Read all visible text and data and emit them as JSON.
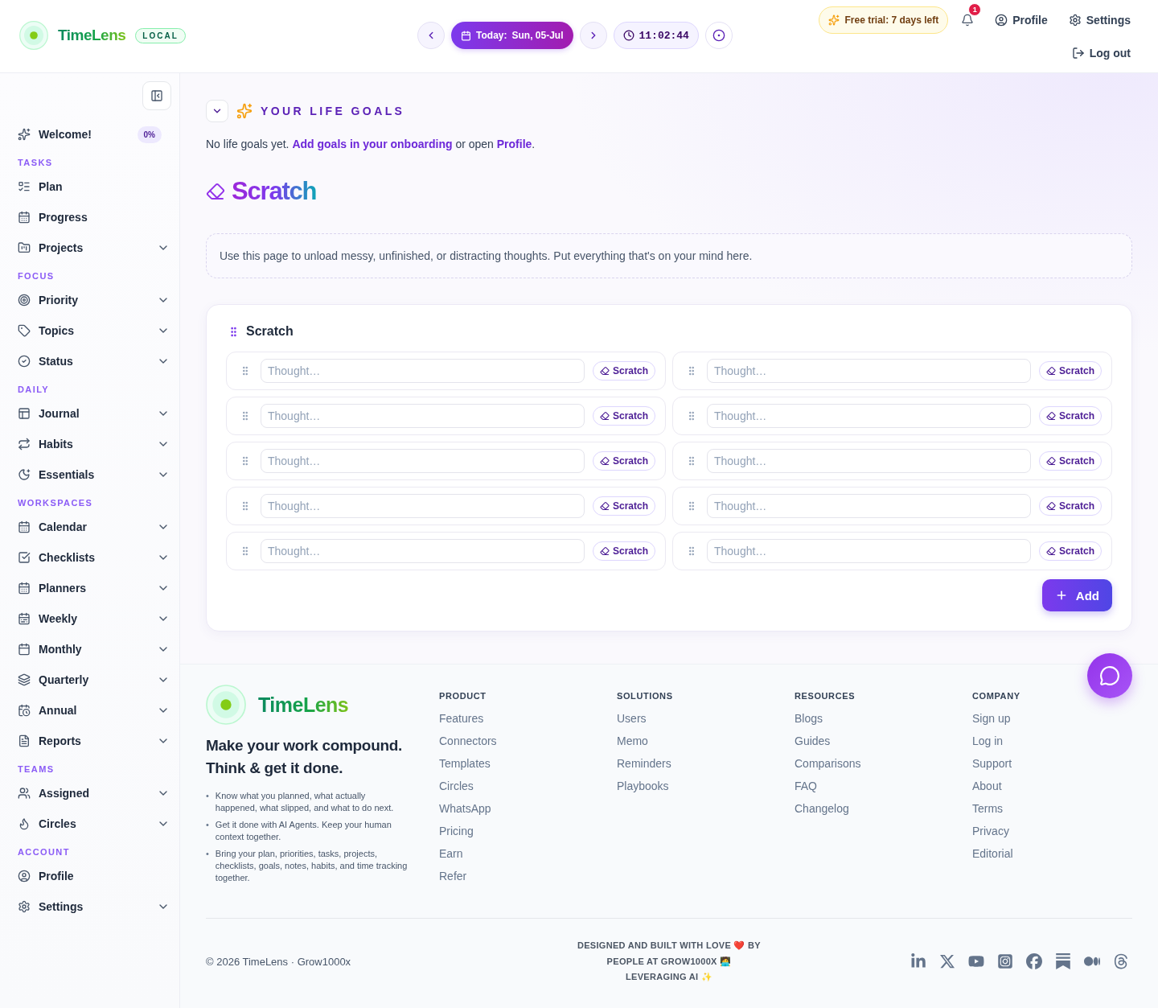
{
  "header": {
    "brand": "TimeLens",
    "badge": "LOCAL",
    "date": {
      "label": "Today:",
      "value": "Sun, 05-Jul"
    },
    "time": "11:02:44",
    "trial": "Free trial: 7 days left",
    "notifications": "1",
    "profile": "Profile",
    "settings": "Settings",
    "logout": "Log out"
  },
  "sidebar": {
    "welcome": {
      "label": "Welcome!",
      "progress": "0%"
    },
    "sections": [
      {
        "title": "TASKS",
        "items": [
          {
            "label": "Plan",
            "kind": "link"
          },
          {
            "label": "Progress",
            "kind": "link"
          },
          {
            "label": "Projects",
            "kind": "group"
          }
        ]
      },
      {
        "title": "FOCUS",
        "items": [
          {
            "label": "Priority",
            "kind": "group"
          },
          {
            "label": "Topics",
            "kind": "group"
          },
          {
            "label": "Status",
            "kind": "group"
          }
        ]
      },
      {
        "title": "DAILY",
        "items": [
          {
            "label": "Journal",
            "kind": "group"
          },
          {
            "label": "Habits",
            "kind": "group"
          },
          {
            "label": "Essentials",
            "kind": "group"
          }
        ]
      },
      {
        "title": "WORKSPACES",
        "items": [
          {
            "label": "Calendar",
            "kind": "group"
          },
          {
            "label": "Checklists",
            "kind": "group"
          },
          {
            "label": "Planners",
            "kind": "group"
          },
          {
            "label": "Weekly",
            "kind": "group"
          },
          {
            "label": "Monthly",
            "kind": "group"
          },
          {
            "label": "Quarterly",
            "kind": "group"
          },
          {
            "label": "Annual",
            "kind": "group"
          },
          {
            "label": "Reports",
            "kind": "group"
          }
        ]
      },
      {
        "title": "TEAMS",
        "items": [
          {
            "label": "Assigned",
            "kind": "group"
          },
          {
            "label": "Circles",
            "kind": "group"
          }
        ]
      },
      {
        "title": "ACCOUNT",
        "items": [
          {
            "label": "Profile",
            "kind": "link"
          },
          {
            "label": "Settings",
            "kind": "group"
          }
        ]
      }
    ]
  },
  "life_goals": {
    "title": "YOUR LIFE GOALS",
    "message": [
      {
        "kind": "text",
        "text": "No life goals yet. "
      },
      {
        "kind": "link",
        "text": "Add goals in your onboarding"
      },
      {
        "kind": "text",
        "text": " or open "
      },
      {
        "kind": "link",
        "text": "Profile"
      },
      {
        "kind": "text",
        "text": "."
      }
    ]
  },
  "page": {
    "title": "Scratch",
    "intro": "Use this page to unload messy, unfinished, or distracting thoughts. Put everything that's on your mind here."
  },
  "scratch_card": {
    "title": "Scratch",
    "items": [
      {
        "placeholder": "Thought…",
        "button": "Scratch"
      },
      {
        "placeholder": "Thought…",
        "button": "Scratch"
      },
      {
        "placeholder": "Thought…",
        "button": "Scratch"
      },
      {
        "placeholder": "Thought…",
        "button": "Scratch"
      },
      {
        "placeholder": "Thought…",
        "button": "Scratch"
      },
      {
        "placeholder": "Thought…",
        "button": "Scratch"
      },
      {
        "placeholder": "Thought…",
        "button": "Scratch"
      },
      {
        "placeholder": "Thought…",
        "button": "Scratch"
      },
      {
        "placeholder": "Thought…",
        "button": "Scratch"
      },
      {
        "placeholder": "Thought…",
        "button": "Scratch"
      }
    ],
    "add_button": "Add"
  },
  "footer": {
    "brand": "TimeLens",
    "tagline": [
      "Make your work compound.",
      "Think & get it done."
    ],
    "bullets": [
      {
        "marker": "•",
        "text": "Know what you planned, what actually happened, what slipped, and what to do next."
      },
      {
        "marker": "•",
        "text": "Get it done with AI Agents. Keep your human context together."
      },
      {
        "marker": "•",
        "text": "Bring your plan, priorities, tasks, projects, checklists, goals, notes, habits, and time tracking together."
      }
    ],
    "columns": [
      {
        "title": "PRODUCT",
        "links": [
          "Features",
          "Connectors",
          "Templates",
          "Circles",
          "WhatsApp",
          "Pricing",
          "Earn",
          "Refer"
        ]
      },
      {
        "title": "SOLUTIONS",
        "links": [
          "Users",
          "Memo",
          "Reminders",
          "Playbooks"
        ]
      },
      {
        "title": "RESOURCES",
        "links": [
          "Blogs",
          "Guides",
          "Comparisons",
          "FAQ",
          "Changelog"
        ]
      },
      {
        "title": "COMPANY",
        "links": [
          "Sign up",
          "Log in",
          "Support",
          "About",
          "Terms",
          "Privacy",
          "Editorial"
        ]
      }
    ],
    "copyright": "© 2026 TimeLens · Grow1000x",
    "credits": "DESIGNED AND BUILT WITH LOVE ❤️ BY PEOPLE AT GROW1000X 🧑‍💻 LEVERAGING AI ✨"
  }
}
